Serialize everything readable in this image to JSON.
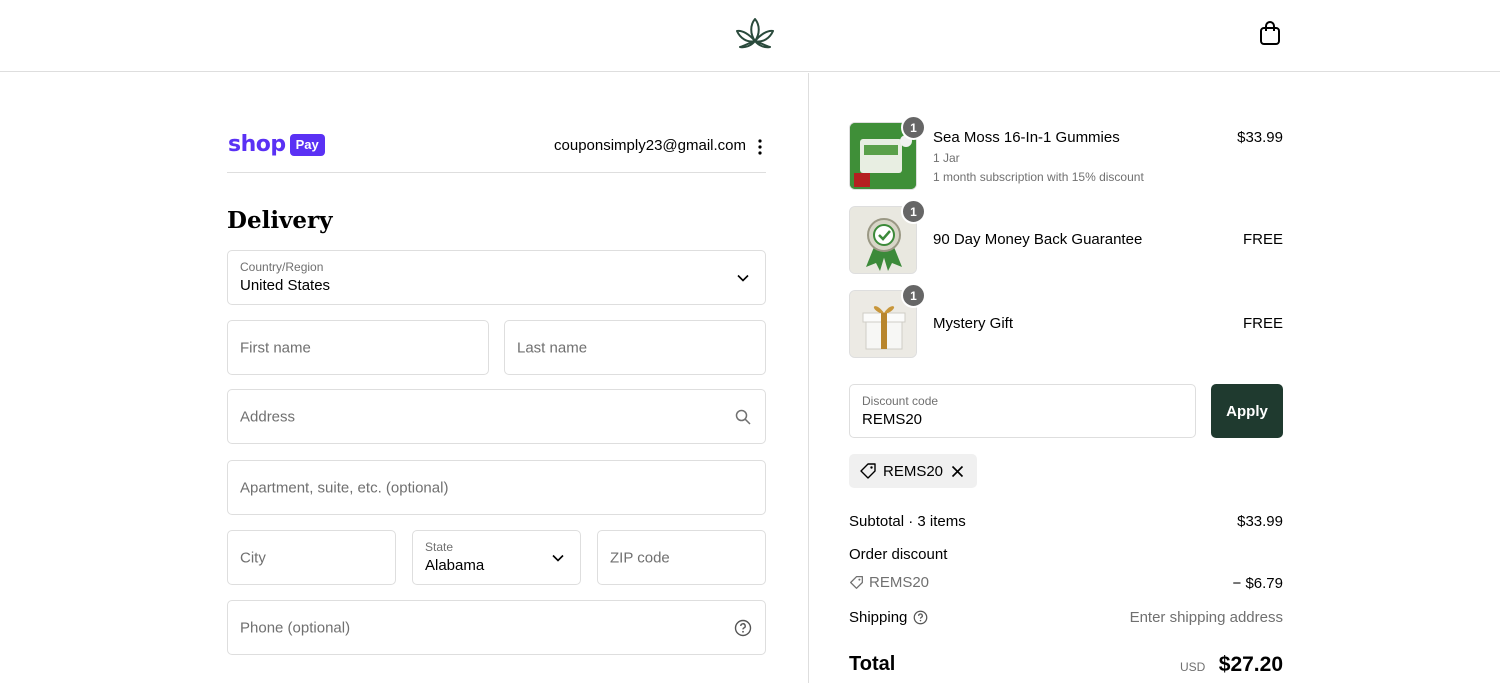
{
  "header": {
    "logo_icon": "leaf-logo-icon",
    "cart_icon": "shopping-bag-icon"
  },
  "account": {
    "shop_pay_word": "shop",
    "shop_pay_badge": "Pay",
    "email": "couponsimply23@gmail.com"
  },
  "delivery": {
    "title": "Delivery",
    "country_label": "Country/Region",
    "country_value": "United States",
    "first_name_placeholder": "First name",
    "last_name_placeholder": "Last name",
    "address_placeholder": "Address",
    "apartment_placeholder": "Apartment, suite, etc. (optional)",
    "city_placeholder": "City",
    "state_label": "State",
    "state_value": "Alabama",
    "zip_placeholder": "ZIP code",
    "phone_placeholder": "Phone (optional)"
  },
  "cart": {
    "items": [
      {
        "qty": "1",
        "name": "Sea Moss 16-In-1 Gummies",
        "variant": "1 Jar",
        "plan": "1 month subscription with 15% discount",
        "price": "$33.99"
      },
      {
        "qty": "1",
        "name": "90 Day Money Back Guarantee",
        "price": "FREE"
      },
      {
        "qty": "1",
        "name": "Mystery Gift",
        "price": "FREE"
      }
    ],
    "discount_label": "Discount code",
    "discount_value": "REMS20",
    "apply_label": "Apply",
    "applied_code": "REMS20"
  },
  "summary": {
    "subtotal_label": "Subtotal · 3 items",
    "subtotal_value": "$33.99",
    "order_discount_label": "Order discount",
    "discount_code": "REMS20",
    "discount_value": "− $6.79",
    "shipping_label": "Shipping",
    "shipping_value": "Enter shipping address",
    "total_label": "Total",
    "currency": "USD",
    "total_value": "$27.20"
  },
  "colors": {
    "shop_pay": "#5a31f4",
    "apply_button": "#1f3a2f",
    "logo": "#2a4a3c"
  }
}
